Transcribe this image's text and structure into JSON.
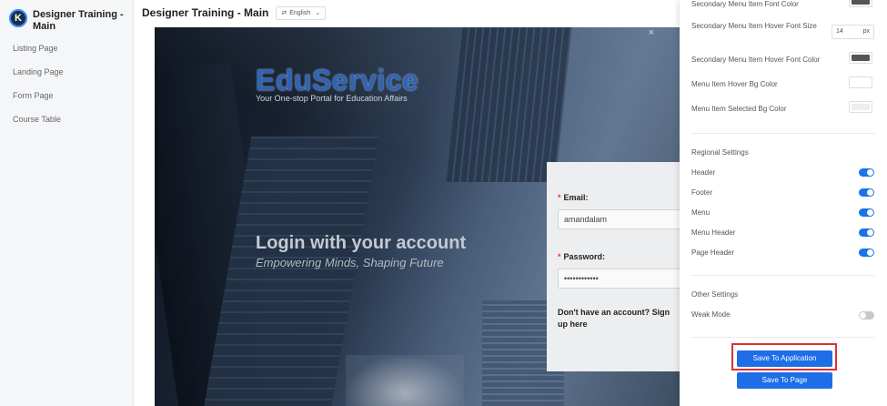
{
  "sidebar": {
    "brand": "Designer Training - Main",
    "logo_letter": "K",
    "items": [
      "Listing Page",
      "Landing Page",
      "Form Page",
      "Course Table"
    ]
  },
  "header": {
    "title": "Designer Training - Main",
    "language": "English",
    "language_icon": "translate-icon"
  },
  "canvas": {
    "close_glyph": "×",
    "logo": "EduService",
    "tagline": "Your One-stop Portal for Education Affairs",
    "heading": "Login with your account",
    "subheading": "Empowering Minds, Shaping Future",
    "email_label": "Email:",
    "email_value": "amandalam",
    "password_label": "Password:",
    "password_value": "••••••••••••",
    "required_mark": "*",
    "signup_text": "Don't have an account? Sign up here"
  },
  "settings": {
    "secondary_font_color": "Secondary Menu Item Font Color",
    "secondary_font_color_value": "#555555",
    "hover_font_size": "Secondary Menu Item Hover Font Size",
    "hover_font_size_value": "14",
    "hover_font_size_unit": "px",
    "hover_font_color": "Secondary Menu Item Hover Font Color",
    "hover_font_color_value": "#555555",
    "hover_bg": "Menu Item Hover Bg Color",
    "hover_bg_value": "#ffffff",
    "selected_bg": "Menu Item Selected Bg Color",
    "selected_bg_value": "#eeeeee",
    "regional_title": "Regional Settings",
    "regional": [
      {
        "label": "Header",
        "on": true
      },
      {
        "label": "Footer",
        "on": true
      },
      {
        "label": "Menu",
        "on": true
      },
      {
        "label": "Menu Header",
        "on": true
      },
      {
        "label": "Page Header",
        "on": true
      }
    ],
    "other_title": "Other Settings",
    "weak_mode": "Weak Mode",
    "weak_mode_on": false,
    "save_app": "Save To Application",
    "save_page": "Save To Page"
  }
}
